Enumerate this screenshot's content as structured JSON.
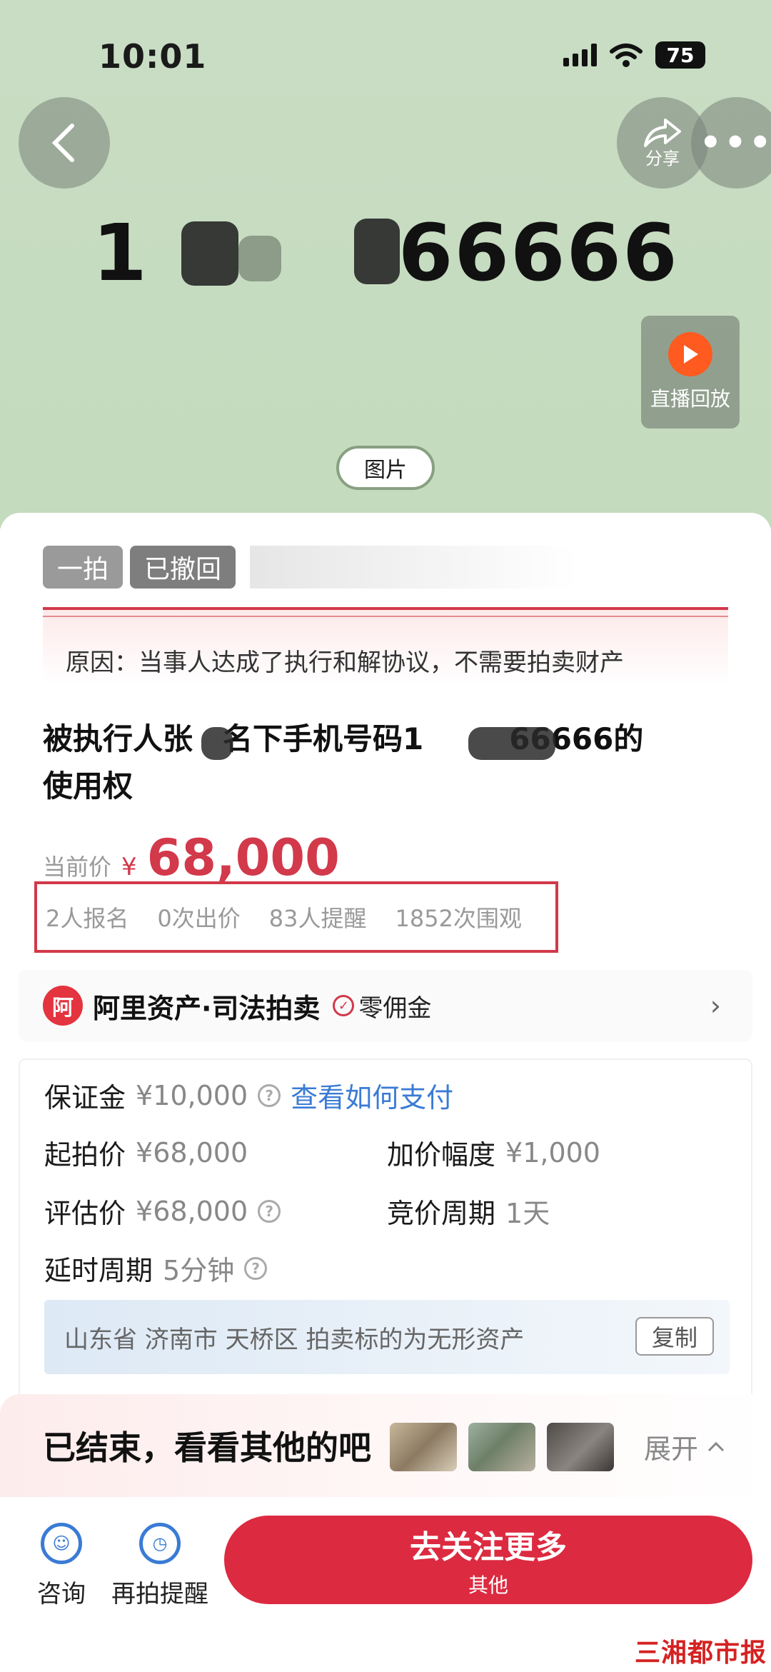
{
  "status_bar": {
    "time": "10:01",
    "battery": "75"
  },
  "hero": {
    "number_prefix": "1",
    "number_suffix": "66666",
    "share_label": "分享",
    "replay_label": "直播回放",
    "picture_pill": "图片"
  },
  "tags": {
    "round": "一拍",
    "status": "已撤回"
  },
  "reason": "原因：当事人达成了执行和解协议，不需要拍卖财产",
  "title": {
    "part1": "被执行人张",
    "part2": "名下手机号码1",
    "part3": "66666的",
    "part4": "使用权"
  },
  "price": {
    "label": "当前价",
    "currency": "¥",
    "value": "68,000"
  },
  "stats": [
    "2人报名",
    "0次出价",
    "83人提醒",
    "1852次围观"
  ],
  "platform": {
    "logo_text": "阿",
    "name": "阿里资产·司法拍卖",
    "zero_fee": "零佣金"
  },
  "info": {
    "deposit_label": "保证金",
    "deposit_value": "¥10,000",
    "pay_link": "查看如何支付",
    "start_label": "起拍价",
    "start_value": "¥68,000",
    "increment_label": "加价幅度",
    "increment_value": "¥1,000",
    "appraisal_label": "评估价",
    "appraisal_value": "¥68,000",
    "cycle_label": "竞价周期",
    "cycle_value": "1天",
    "delay_label": "延时周期",
    "delay_value": "5分钟",
    "address": "山东省 济南市 天桥区 拍卖标的为无形资产",
    "copy_label": "复制"
  },
  "ended": {
    "text": "已结束，看看其他的吧",
    "expand": "展开"
  },
  "bottom": {
    "consult": "咨询",
    "remind": "再拍提醒",
    "cta_main": "去关注更多",
    "cta_sub": "其他"
  },
  "watermark": "三湘都市报",
  "colors": {
    "accent": "#dc2a40",
    "link": "#3a7bd5",
    "hero_bg": "#c7dcc1"
  }
}
